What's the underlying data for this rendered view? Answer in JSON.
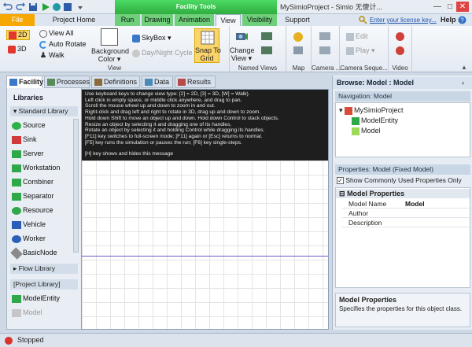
{
  "titlebar": {
    "context_group": "Facility Tools",
    "window_title": "MySimioProject - Simio 无傻计...",
    "minimize": "—",
    "maximize": "□",
    "close": "✕"
  },
  "ribbon_tabs": {
    "file": "File",
    "project_home": "Project Home",
    "run": "Run",
    "drawing": "Drawing",
    "animation": "Animation",
    "view": "View",
    "visibility": "Visibility",
    "support": "Support",
    "license_link": "Enter your license key...",
    "help": "Help"
  },
  "ribbon": {
    "view_group": {
      "btn_2d": "2D",
      "btn_3d": "3D",
      "view_all": "View All",
      "auto_rotate": "Auto Rotate",
      "walk": "Walk",
      "background_color": "Background",
      "background_color_2": "Color ▾",
      "skybox": "SkyBox",
      "day_night": "Day/Night Cycle",
      "snap_to_grid": "Snap To",
      "snap_to_grid_2": "Grid",
      "label": "View"
    },
    "named_views": {
      "change_view": "Change",
      "change_view_2": "View ▾",
      "label": "Named Views"
    },
    "map": {
      "label": "Map"
    },
    "camera": {
      "label": "Camera ..."
    },
    "camera_seq": {
      "edit": "Edit",
      "play": "Play ▾",
      "label": "Camera Seque..."
    },
    "video": {
      "label": "Video"
    }
  },
  "view_tabs": [
    "Facility",
    "Processes",
    "Definitions",
    "Data",
    "Results"
  ],
  "libraries": {
    "header": "Libraries",
    "standard_library": "Standard Library",
    "items": [
      "Source",
      "Sink",
      "Server",
      "Workstation",
      "Combiner",
      "Separator",
      "Resource",
      "Vehicle",
      "Worker",
      "BasicNode"
    ],
    "flow_library": "Flow Library",
    "project_library": "[Project Library]",
    "project_items": [
      "ModelEntity",
      "Model"
    ]
  },
  "canvas": {
    "help_lines": [
      "Use keyboard keys to change view type: [2] = 2D, [3] = 3D, [W] = Walk).",
      "Left click in empty space, or middle click anywhere, and drag to pan.",
      "Scroll the mouse wheel up and down to zoom in and out.",
      "Right-click and drag left and right to rotate in 3D, drag up and down to zoom.",
      "Hold down Shift to move an object up and down. Hold down Control to stack objects.",
      "Resize an object by selecting it and dragging one of its handles.",
      "Rotate an object by selecting it and holding Control while dragging its handles.",
      "[F11] key switches to full-screen mode; [F11] again or [Esc] returns to normal.",
      "[F5] key runs the simulation or pauses the run; [F6] key single-steps.",
      "",
      "[H] key shows and hides this message"
    ]
  },
  "browse": {
    "title": "Browse: Model : Model",
    "navigation_header": "Navigation: Model",
    "tree": [
      "MySimioProject",
      "ModelEntity",
      "Model"
    ]
  },
  "properties": {
    "header": "Properties: Model (Fixed Model)",
    "show_common": "Show Commonly Used Properties Only",
    "section": "Model Properties",
    "rows": [
      {
        "key": "Model Name",
        "value": "Model"
      },
      {
        "key": "Author",
        "value": ""
      },
      {
        "key": "Description",
        "value": ""
      }
    ],
    "footer_title": "Model Properties",
    "footer_desc": "Specifies the properties for this object class."
  },
  "status": {
    "text": "Stopped"
  },
  "colors": {
    "accent_green": "#2fae3f",
    "file_tab": "#f6a800",
    "canvas_bg": "#ffffff",
    "help_bg": "#1e1e1e"
  }
}
